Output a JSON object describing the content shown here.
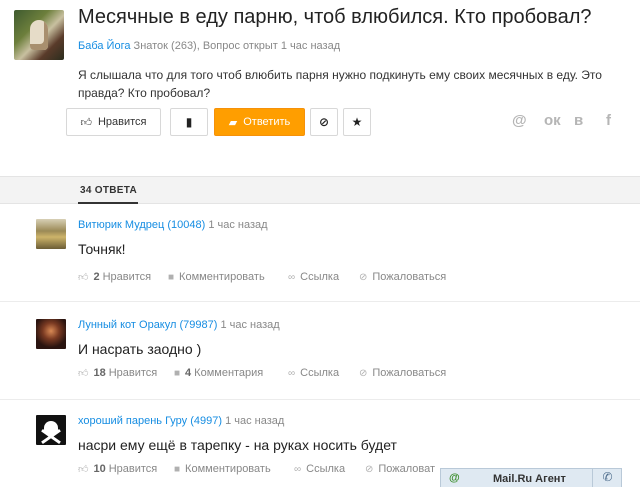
{
  "question": {
    "title": "Месячные в еду парню, чтоб влюбился. Кто пробовал?",
    "author": "Баба Йога",
    "author_rank": "Знаток (263), Вопрос открыт 1 час назад",
    "text": "Я слышала что для того чтоб влюбить парня нужно подкинуть ему своих месячных в еду. Это правда? Кто пробовал?",
    "like_label": "Нравится",
    "answer_label": "Ответить",
    "share_icons": [
      "@",
      "ок",
      "в",
      "f"
    ]
  },
  "answers_header": {
    "count_label": "34 ОТВЕТА"
  },
  "answers": [
    {
      "author": "Витюрик",
      "rank": "Мудрец (10048)",
      "time": "1 час назад",
      "text": "Точняк!",
      "likes": "2",
      "likes_label": "Нравится",
      "comment_label": "Комментировать",
      "link_label": "Ссылка",
      "report_label": "Пожаловаться"
    },
    {
      "author": "Лунный кот",
      "rank": "Оракул (79987)",
      "time": "1 час назад",
      "text": "И насрать заодно )",
      "likes": "18",
      "likes_label": "Нравится",
      "comments": "4",
      "comment_label": "Комментария",
      "link_label": "Ссылка",
      "report_label": "Пожаловаться"
    },
    {
      "author": "хороший парень",
      "rank": "Гуру (4997)",
      "time": "1 час назад",
      "text": "насри ему ещё в тарепку - на руках носить будет",
      "likes": "10",
      "likes_label": "Нравится",
      "comment_label": "Комментировать",
      "link_label": "Ссылка",
      "report_label": "Пожаловат"
    }
  ],
  "agent": {
    "at": "@",
    "title": "Mail.Ru Агент"
  },
  "colors": {
    "accent": "#ff9e00",
    "link": "#168de2"
  }
}
